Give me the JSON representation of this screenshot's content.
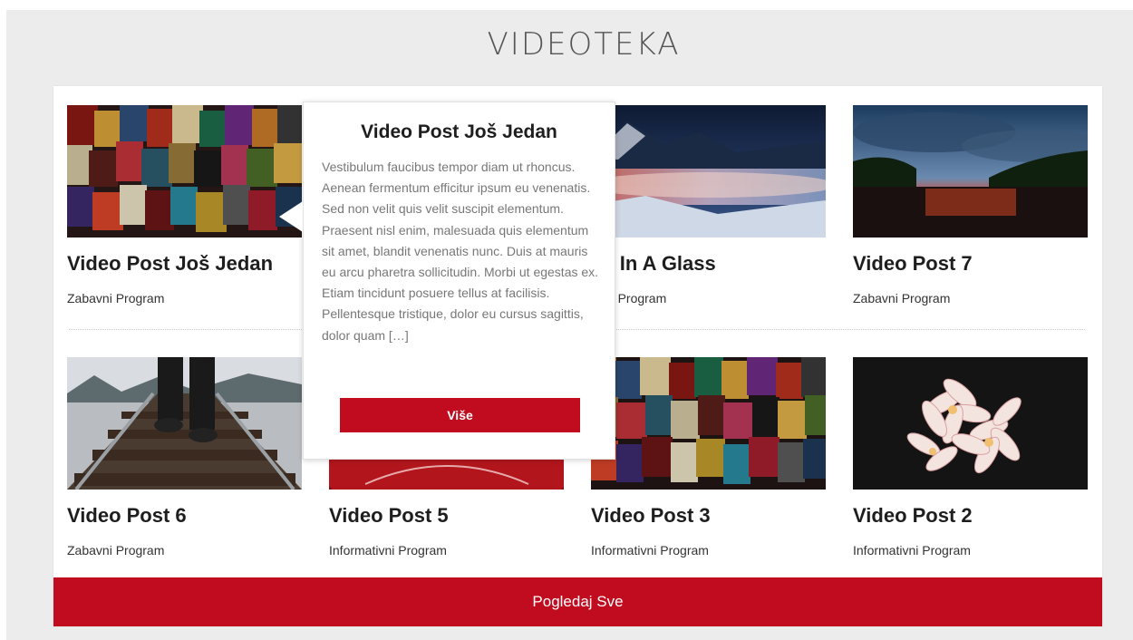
{
  "section": {
    "title": "VIDEOTEKA"
  },
  "videos": [
    {
      "title": "Video Post Još Jedan",
      "category": "Zabavni Program"
    },
    {
      "title": "",
      "category": ""
    },
    {
      "title": "sh In A Glass",
      "category": "avni Program"
    },
    {
      "title": "Video Post 7",
      "category": "Zabavni Program"
    },
    {
      "title": "Video Post 6",
      "category": "Zabavni Program"
    },
    {
      "title": "Video Post 5",
      "category": "Informativni Program"
    },
    {
      "title": "Video Post 3",
      "category": "Informativni Program"
    },
    {
      "title": "Video Post 2",
      "category": "Informativni Program"
    }
  ],
  "popover": {
    "title": "Video Post Još Jedan",
    "excerpt": "Vestibulum faucibus tempor diam ut rhoncus. Aenean fermentum efficitur ipsum eu venenatis. Sed non velit quis velit suscipit elementum. Praesent nisl enim, malesuada quis elementum sit amet, blandit venenatis nunc. Duis at mauris eu arcu pharetra sollicitudin. Morbi ut egestas ex. Etiam tincidunt posuere tellus at facilisis. Pellentesque tristique, dolor eu cursus sagittis, dolor quam […]",
    "more_label": "Više"
  },
  "footer": {
    "view_all_label": "Pogledaj Sve"
  },
  "colors": {
    "accent": "#c10c1f",
    "page_background": "#ececec",
    "card_background": "#ffffff",
    "title_text": "#1e1e1e",
    "excerpt_text": "#777777"
  }
}
